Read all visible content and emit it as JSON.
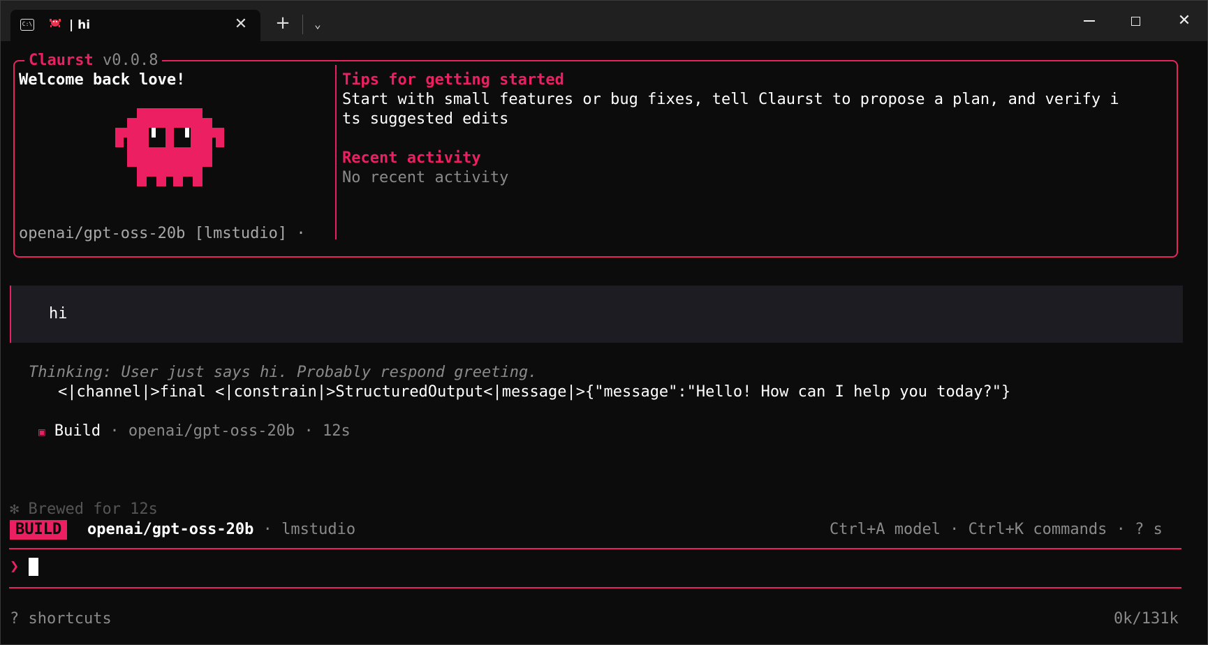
{
  "titlebar": {
    "tab_title": "| hi",
    "tab_icon": "terminal-icon",
    "tab_icon_text": "C:\\",
    "tab_emoji": "crab-icon",
    "close_glyph": "✕",
    "new_tab_glyph": "+",
    "dropdown_glyph": "⌄",
    "close_window_glyph": "✕"
  },
  "welcome": {
    "app_name": "Claurst",
    "version": "v0.0.8",
    "greeting": "Welcome back love!",
    "model_line": "openai/gpt-oss-20b [lmstudio] ·",
    "tips_heading": "Tips for getting started",
    "tips_line1": "Start with small features or bug fixes, tell Claurst to propose a plan, and verify i",
    "tips_line2": "ts suggested edits",
    "recent_heading": "Recent activity",
    "recent_text": "No recent activity"
  },
  "conversation": {
    "user_message": "hi",
    "thinking_label": "Thinking:",
    "thinking_text": " User just says hi. Probably respond greeting.",
    "response": "<|channel|>final <|constrain|>StructuredOutput<|message|>{\"message\":\"Hello! How can I help you today?\"}",
    "build_marker": "▣",
    "build_label": "Build",
    "build_meta": " · openai/gpt-oss-20b · 12s"
  },
  "status": {
    "brewed": "✻ Brewed for 12s",
    "mode_badge": "BUILD",
    "model": "openai/gpt-oss-20b",
    "provider": " · lmstudio",
    "hints": "Ctrl+A model · Ctrl+K commands · ? s",
    "prompt_glyph": "❯",
    "shortcuts": "? shortcuts",
    "tokens": "0k/131k"
  },
  "colors": {
    "accent": "#ec1f62",
    "background": "#0c0c0c",
    "message_bg": "#1c1c22"
  }
}
